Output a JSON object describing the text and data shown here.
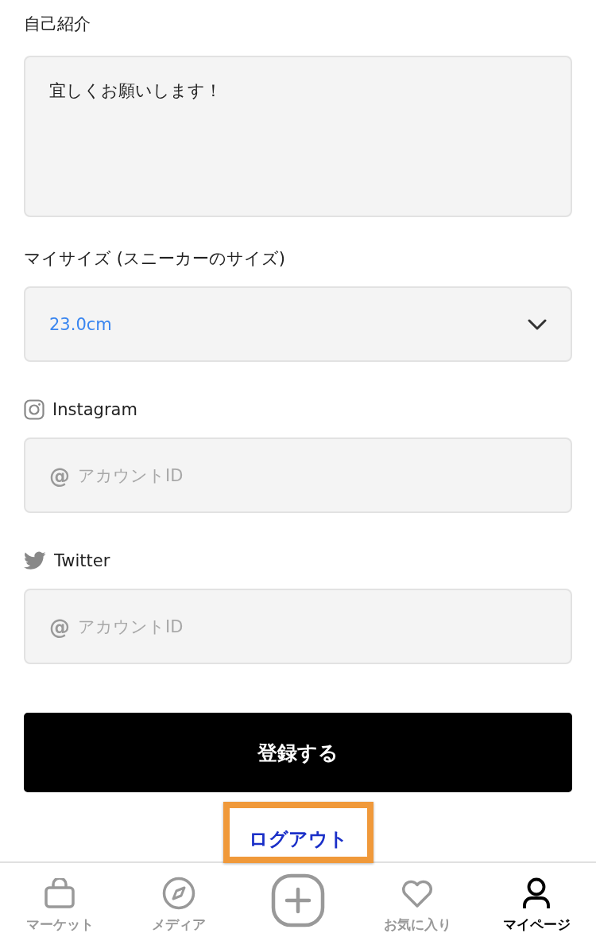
{
  "bio": {
    "label": "自己紹介",
    "value": "宜しくお願いします！"
  },
  "size": {
    "label": "マイサイズ (スニーカーのサイズ)",
    "value": "23.0cm"
  },
  "social": [
    {
      "kind": "instagram",
      "label": "Instagram",
      "prefix": "@",
      "placeholder": "アカウントID"
    },
    {
      "kind": "twitter",
      "label": "Twitter",
      "prefix": "@",
      "placeholder": "アカウントID"
    }
  ],
  "submit": "登録する",
  "logout": {
    "label": "ログアウト",
    "highlighted": true
  },
  "tab_bar": [
    {
      "kind": "market",
      "label": "マーケット",
      "selected": false
    },
    {
      "kind": "media",
      "label": "メディア",
      "selected": false
    },
    {
      "kind": "post",
      "selected": false
    },
    {
      "kind": "favorites",
      "label": "お気に入り",
      "selected": false
    },
    {
      "kind": "mypage",
      "label": "マイページ",
      "selected": true
    }
  ]
}
